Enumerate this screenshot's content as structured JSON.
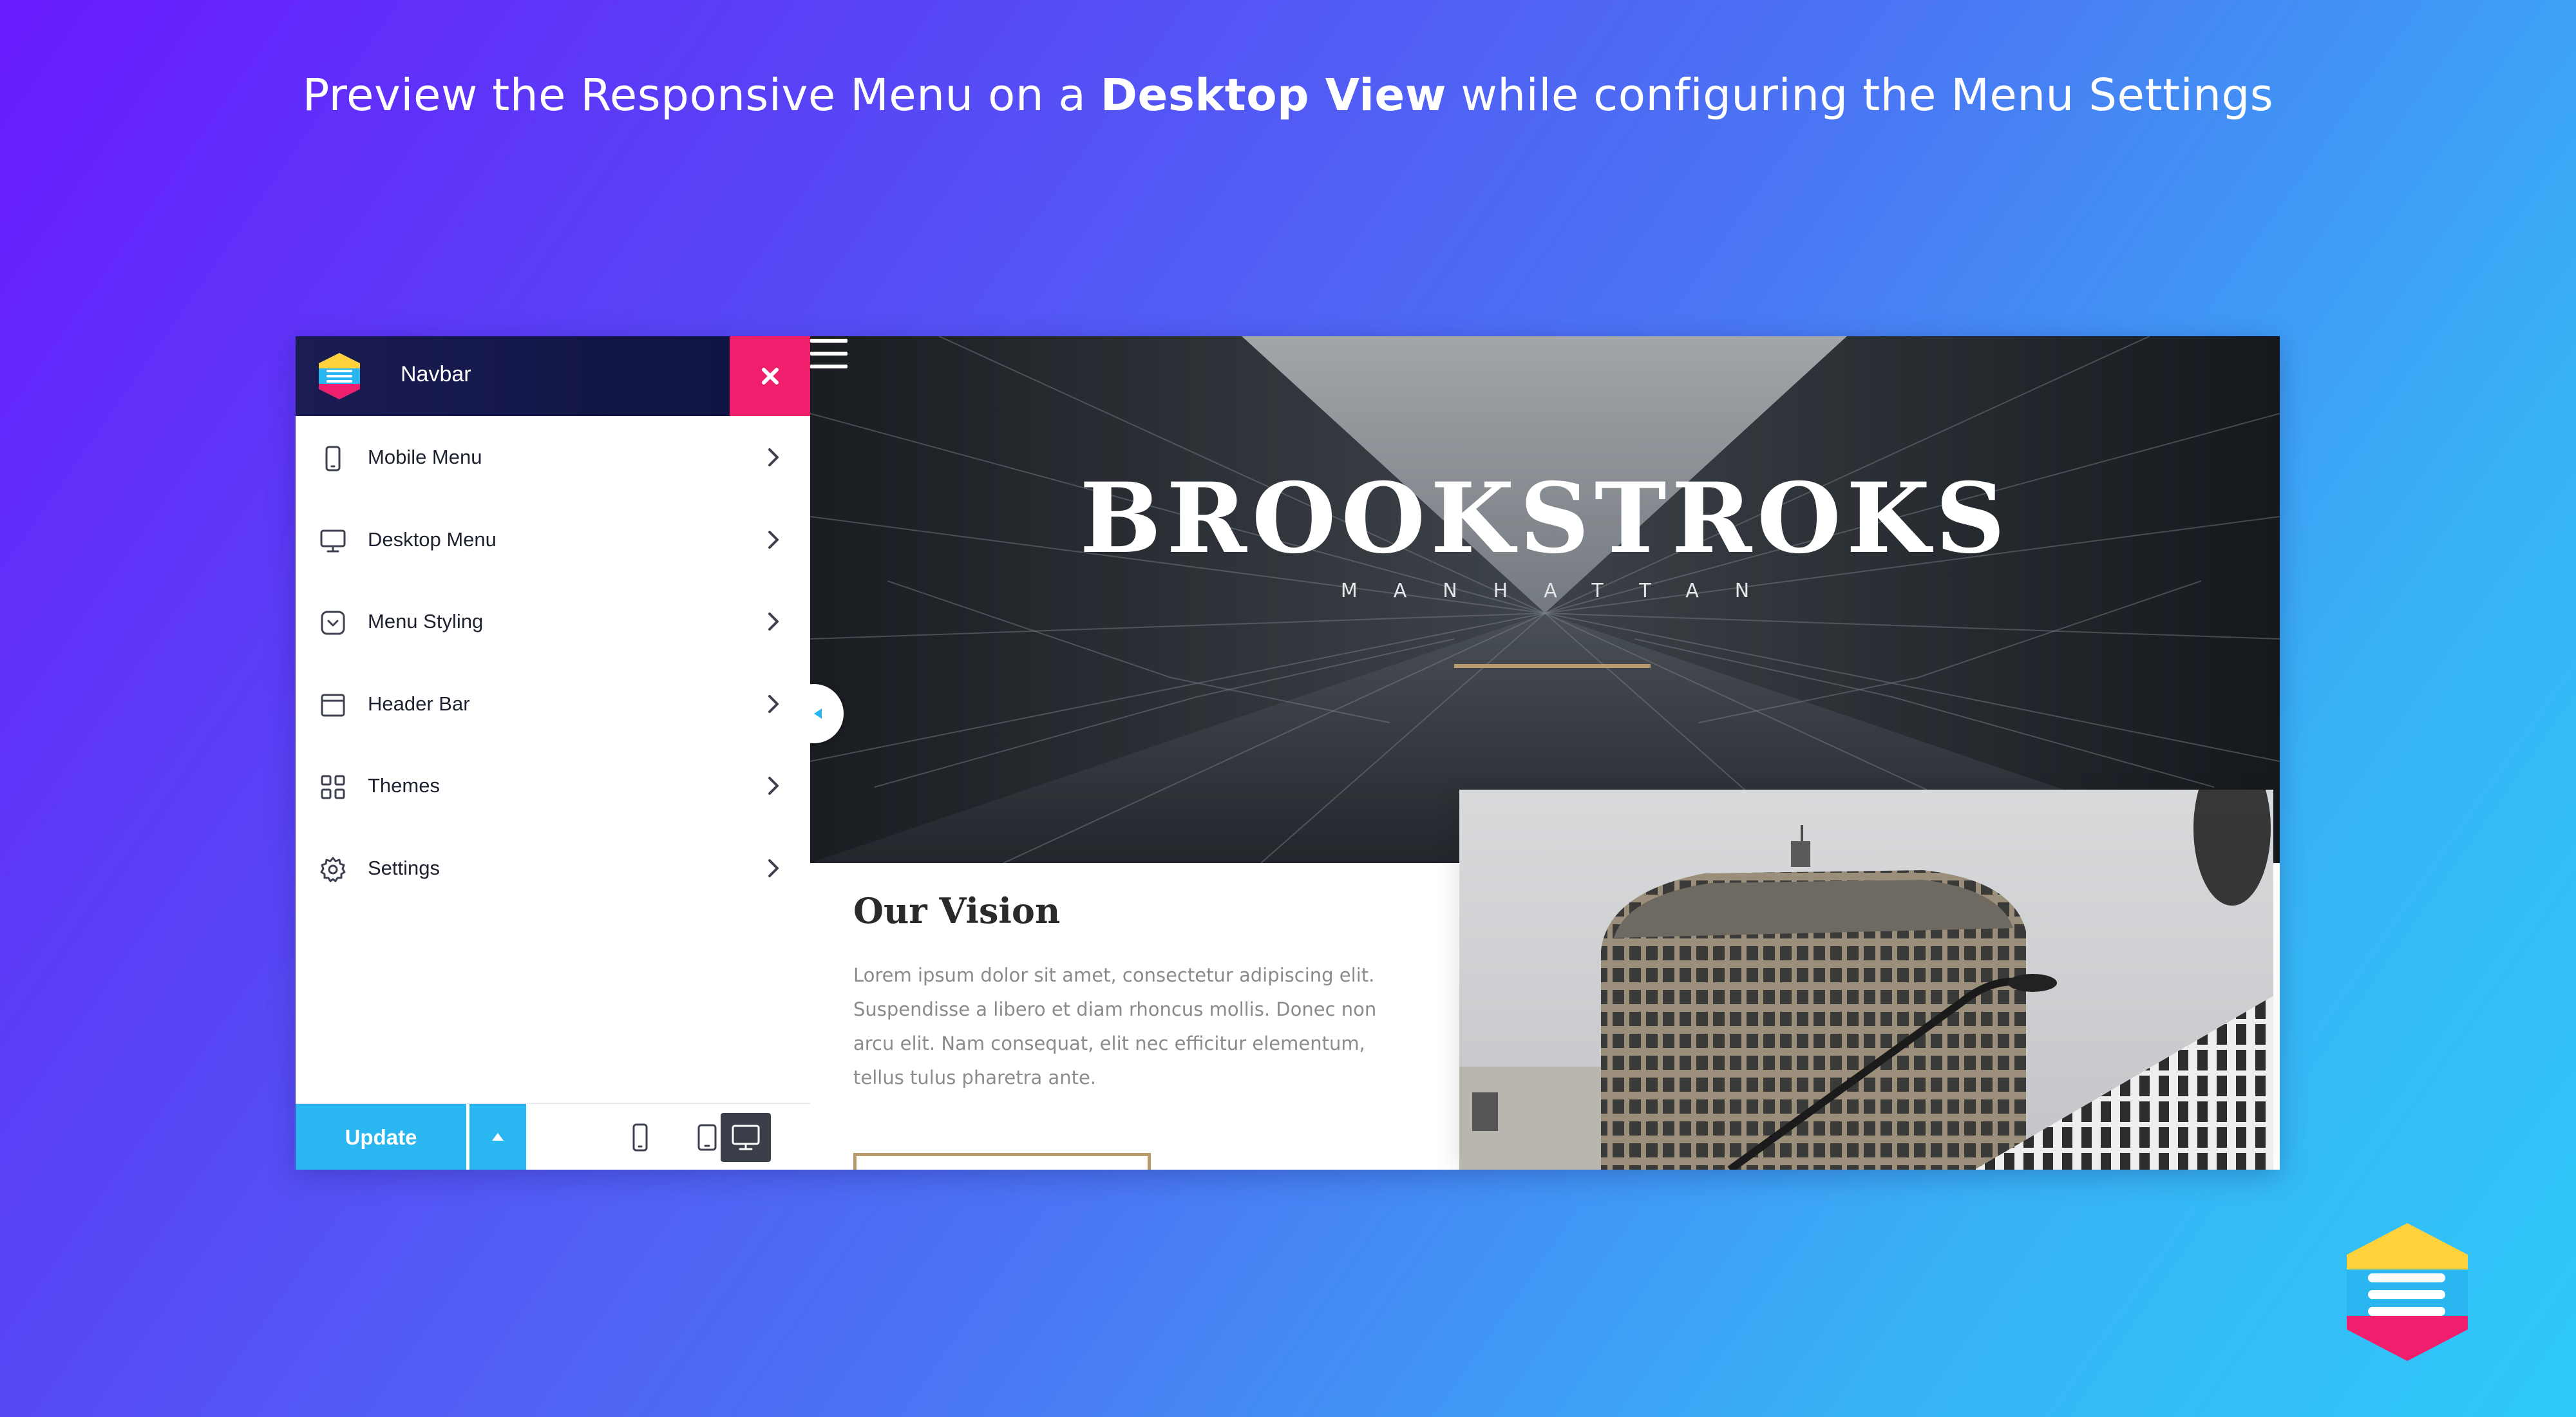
{
  "headline": {
    "before": "Preview the Responsive Menu on a ",
    "bold": "Desktop View",
    "after": " while configuring the Menu Settings"
  },
  "panel": {
    "title": "Navbar",
    "items": [
      {
        "label": "Mobile Menu",
        "icon": "mobile-icon"
      },
      {
        "label": "Desktop Menu",
        "icon": "desktop-icon"
      },
      {
        "label": "Menu Styling",
        "icon": "menu-styling-icon"
      },
      {
        "label": "Header Bar",
        "icon": "header-bar-icon"
      },
      {
        "label": "Themes",
        "icon": "themes-icon"
      },
      {
        "label": "Settings",
        "icon": "gear-icon"
      }
    ],
    "footer": {
      "update_label": "Update",
      "devices": [
        "mobile",
        "tablet",
        "desktop"
      ],
      "active_device": "desktop"
    }
  },
  "preview": {
    "brand": "BROOKSTROKS",
    "brand_sub": "MANHATTAN",
    "vision_title": "Our Vision",
    "vision_text": "Lorem ipsum dolor sit amet, consectetur adipiscing elit. Suspendisse a libero et diam rhoncus mollis. Donec non arcu elit. Nam consequat, elit nec efficitur elementum, tellus tulus pharetra ante."
  },
  "colors": {
    "accent_blue": "#2ab6f0",
    "close_pink": "#ef1f6d",
    "panel_header": "#1b1c52",
    "gold": "#b89a6c"
  }
}
